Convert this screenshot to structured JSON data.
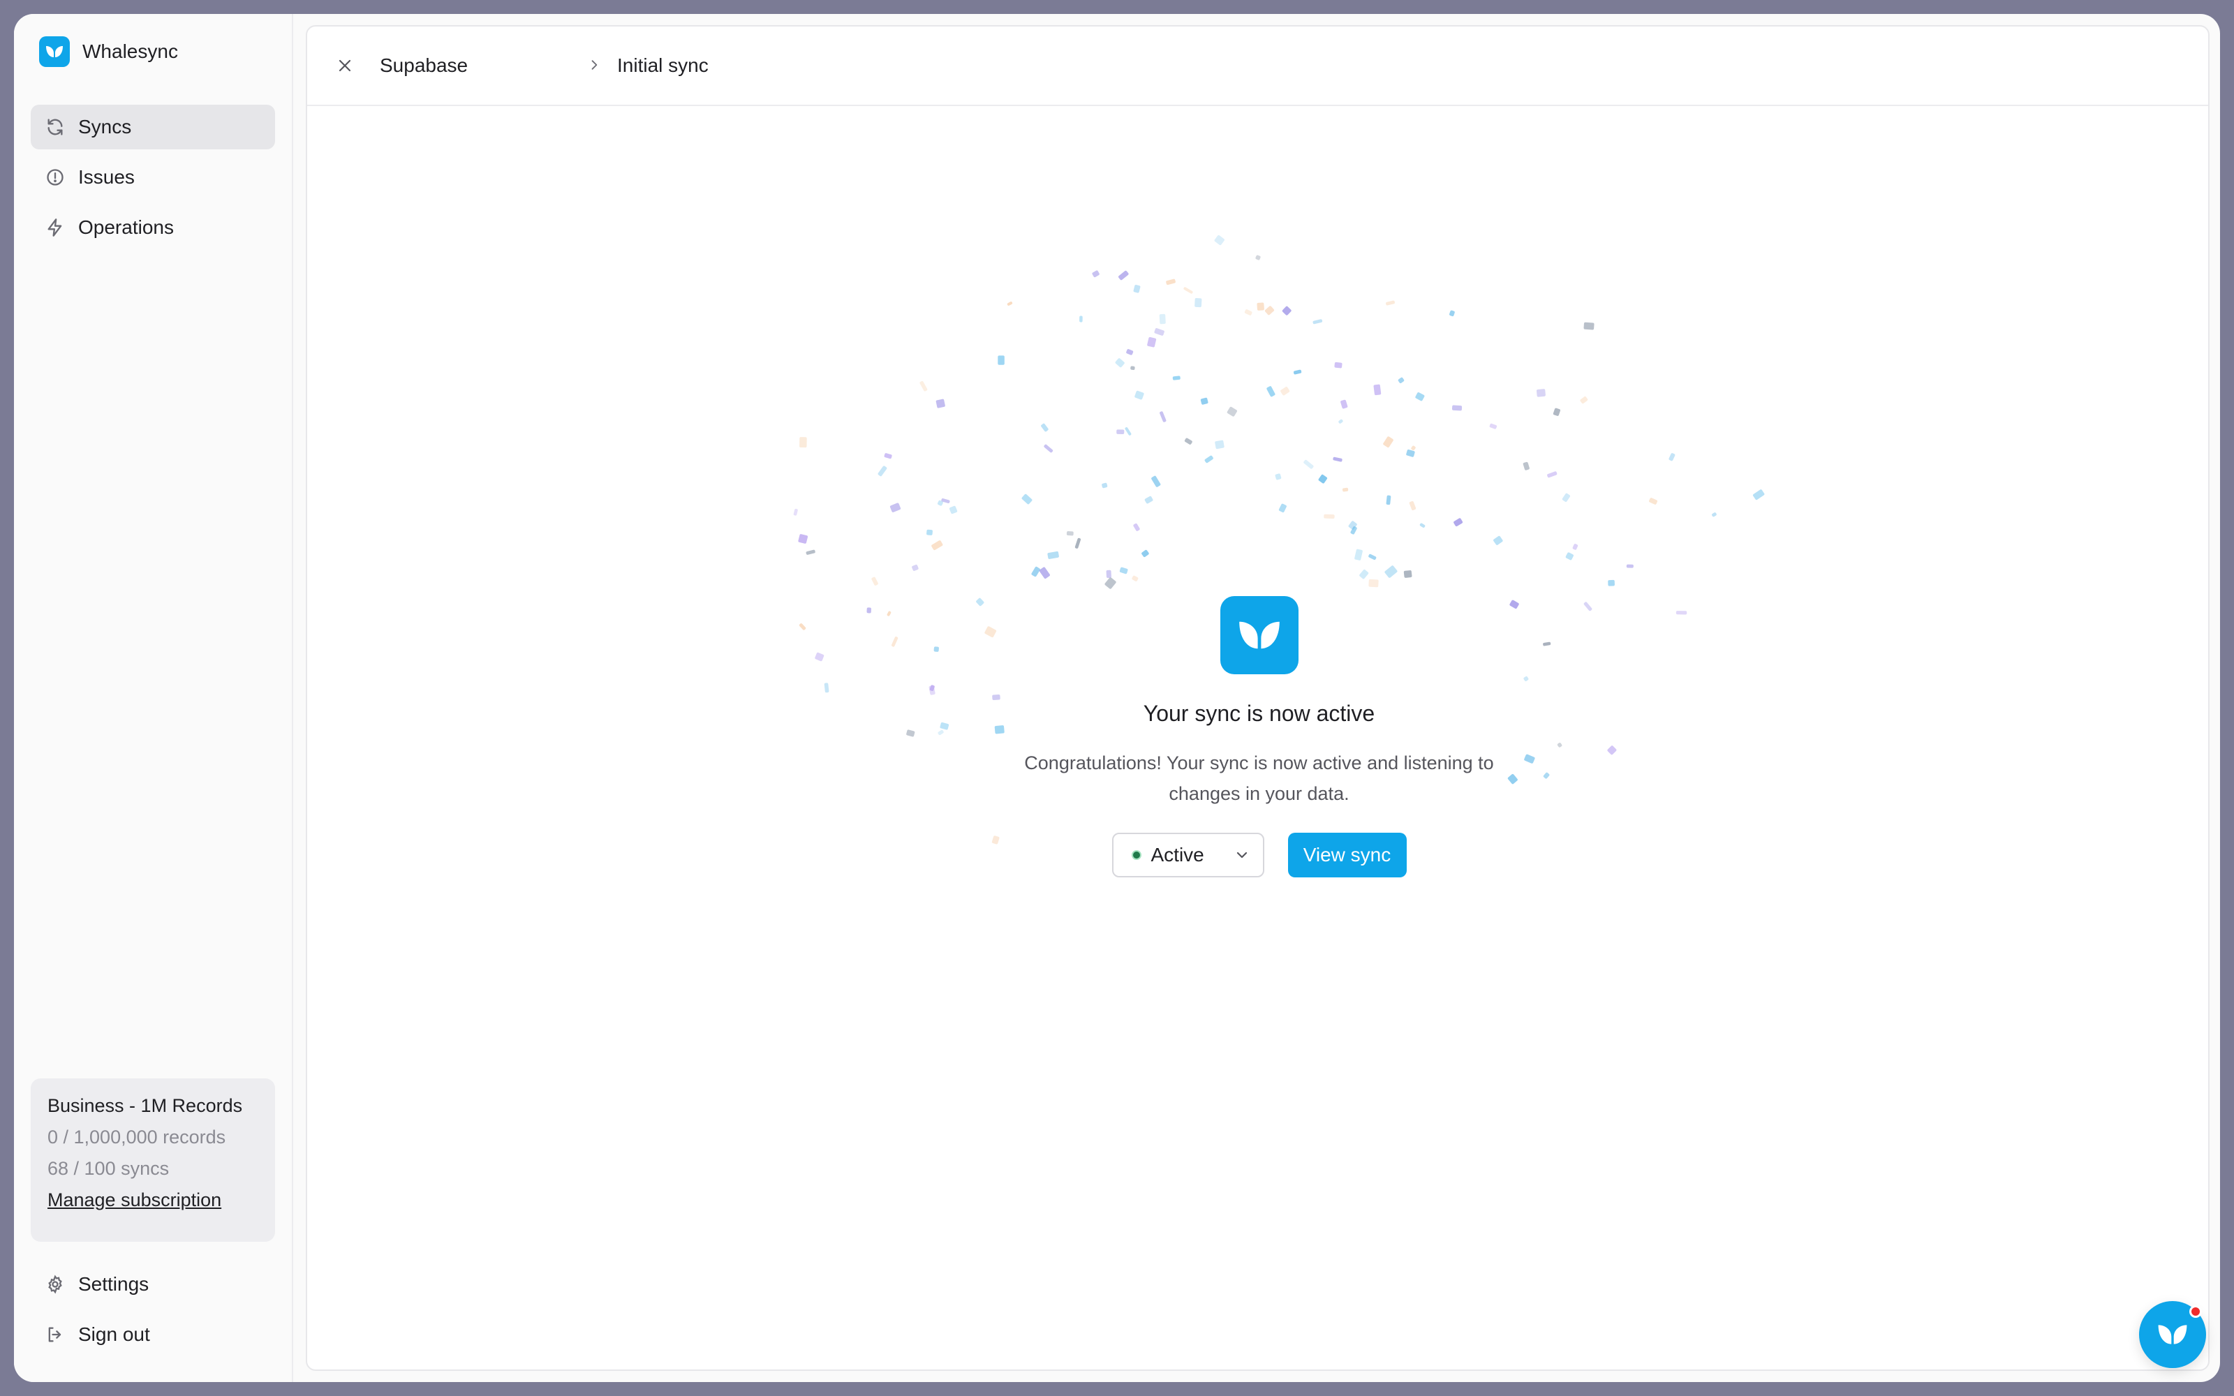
{
  "app": {
    "name": "Whalesync"
  },
  "sidebar": {
    "items": [
      {
        "label": "Syncs",
        "icon": "refresh-icon",
        "active": true
      },
      {
        "label": "Issues",
        "icon": "alert-circle-icon",
        "active": false
      },
      {
        "label": "Operations",
        "icon": "bolt-icon",
        "active": false
      }
    ],
    "plan": {
      "title": "Business - 1M Records",
      "records": "0 / 1,000,000 records",
      "syncs": "68 / 100 syncs",
      "manage": "Manage subscription"
    },
    "bottom": [
      {
        "label": "Settings",
        "icon": "gear-icon"
      },
      {
        "label": "Sign out",
        "icon": "sign-out-icon"
      }
    ]
  },
  "header": {
    "crumb_source": "Supabase",
    "crumb_step": "Initial sync"
  },
  "main": {
    "title": "Your sync is now active",
    "description": "Congratulations! Your sync is now active and listening to changes in your data.",
    "status_value": "Active",
    "view_button": "View sync"
  },
  "colors": {
    "accent": "#0ea5e9",
    "status_active": "#1f7a4a",
    "notification": "#ef2b2b"
  }
}
